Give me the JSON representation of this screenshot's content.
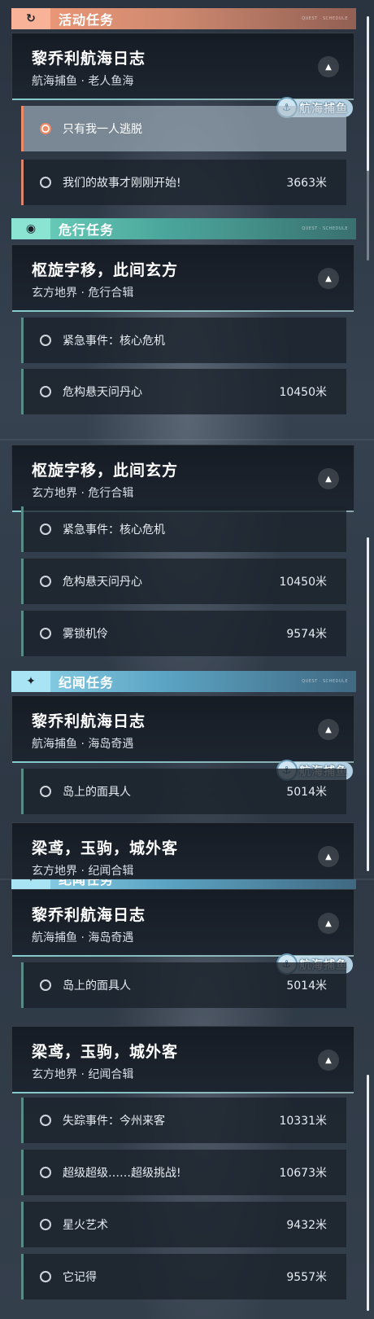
{
  "colors": {
    "activity": "#f19a78",
    "danger": "#6fd5c0",
    "story": "#8fd4ea",
    "active_marker": "#f08a66"
  },
  "deco_text": "QUEST · SCHEDULE",
  "tag_label": "航海捕鱼",
  "collapse_icon": "▲",
  "panel1": {
    "activity": {
      "category": "活动任务",
      "icon": "↻",
      "title": "黎乔利航海日志",
      "subtitle": "航海捕鱼 · 老人鱼海",
      "items": [
        {
          "label": "只有我一人逃脱",
          "dist": "",
          "selected": true
        },
        {
          "label": "我们的故事才刚刚开始!",
          "dist": "3663米"
        }
      ]
    },
    "danger": {
      "category": "危行任务",
      "icon": "◉",
      "title": "枢旋字移，此间玄方",
      "subtitle": "玄方地界 · 危行合辑",
      "items": [
        {
          "label": "紧急事件：核心危机",
          "dist": ""
        },
        {
          "label": "危构悬天问丹心",
          "dist": "10450米"
        }
      ]
    }
  },
  "panel2": {
    "danger": {
      "title": "枢旋字移，此间玄方",
      "subtitle": "玄方地界 · 危行合辑",
      "items": [
        {
          "label": "紧急事件：核心危机",
          "dist": ""
        },
        {
          "label": "危构悬天问丹心",
          "dist": "10450米"
        },
        {
          "label": "雾锁机伶",
          "dist": "9574米"
        }
      ]
    },
    "story": {
      "category": "纪闻任务",
      "icon": "✦",
      "title": "黎乔利航海日志",
      "subtitle": "航海捕鱼 · 海岛奇遇",
      "items": [
        {
          "label": "岛上的面具人",
          "dist": "5014米"
        }
      ]
    },
    "story2": {
      "title": "梁鸢，玉驹，城外客",
      "subtitle": "玄方地界 · 纪闻合辑"
    }
  },
  "panel3": {
    "story": {
      "category": "纪闻任务",
      "title": "黎乔利航海日志",
      "subtitle": "航海捕鱼 · 海岛奇遇",
      "items": [
        {
          "label": "岛上的面具人",
          "dist": "5014米"
        }
      ]
    },
    "story2": {
      "title": "梁鸢，玉驹，城外客",
      "subtitle": "玄方地界 · 纪闻合辑",
      "items": [
        {
          "label": "失踪事件：今州来客",
          "dist": "10331米"
        },
        {
          "label": "超级超级……超级挑战!",
          "dist": "10673米"
        },
        {
          "label": "星火艺术",
          "dist": "9432米"
        },
        {
          "label": "它记得",
          "dist": "9557米"
        }
      ]
    }
  }
}
